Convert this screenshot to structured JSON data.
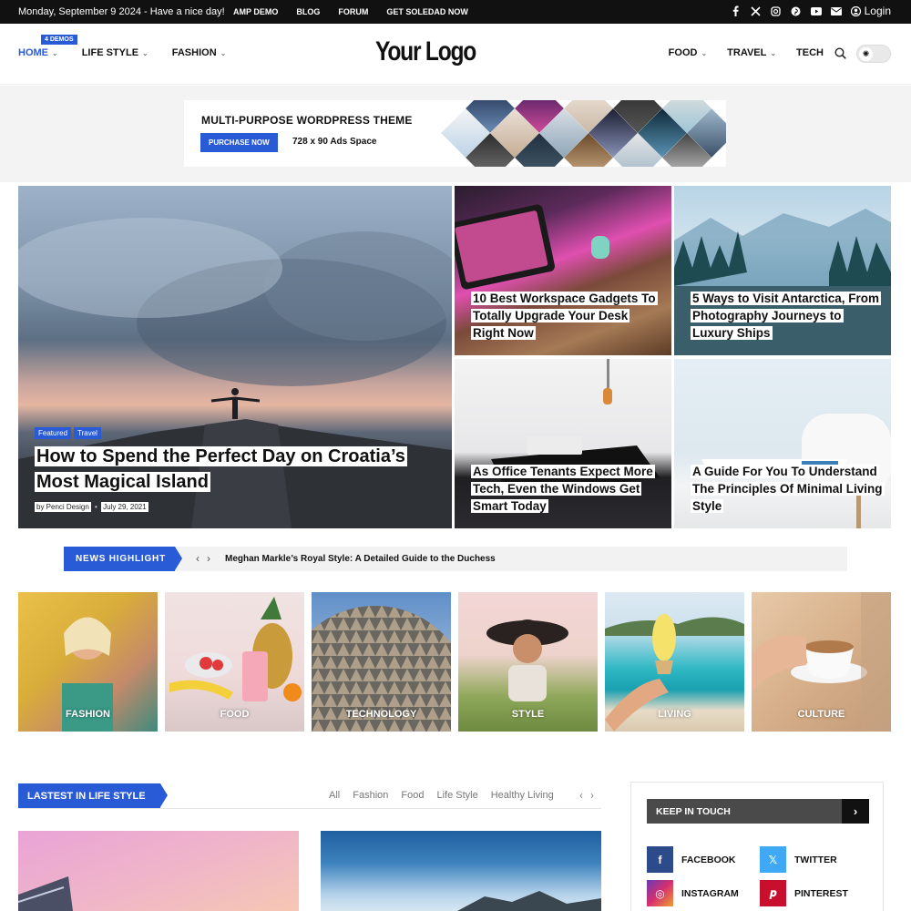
{
  "topbar": {
    "date_text": "Monday, September 9 2024 - Have a nice day!",
    "links": [
      "AMP DEMO",
      "BLOG",
      "FORUM",
      "GET SOLEDAD NOW"
    ],
    "social_icons": [
      "facebook-icon",
      "x-icon",
      "instagram-icon",
      "pinterest-icon",
      "youtube-icon",
      "mail-icon"
    ],
    "login_label": "Login"
  },
  "header": {
    "logo_text": "Your Logo",
    "badge": "4 DEMOS",
    "nav_left": [
      "HOME",
      "LIFE STYLE",
      "FASHION"
    ],
    "nav_right": [
      "FOOD",
      "TRAVEL",
      "TECH"
    ],
    "accent_color": "#2a5bd7"
  },
  "ad": {
    "title": "MULTI-PURPOSE WORDPRESS THEME",
    "button": "PURCHASE NOW",
    "space_text": "728 x 90 Ads Space"
  },
  "hero": {
    "main": {
      "tags": [
        "Featured",
        "Travel"
      ],
      "title": "How to Spend the Perfect Day on Croatia’s Most Magical Island",
      "author": "by Penci Design",
      "date": "July 29, 2021"
    },
    "cards": [
      {
        "title": "10 Best Workspace Gadgets To Totally Upgrade Your Desk Right Now"
      },
      {
        "title": "5 Ways to Visit Antarctica, From Photography Journeys to Luxury Ships"
      },
      {
        "title": "As Office Tenants Expect More Tech, Even the Windows Get Smart Today"
      },
      {
        "title": "A Guide For You To Understand The Principles Of Minimal Living Style"
      }
    ]
  },
  "ticker": {
    "label": "NEWS HIGHLIGHT",
    "headline": "Meghan Markle’s Royal Style: A Detailed Guide to the Duchess"
  },
  "categories": [
    "FASHION",
    "FOOD",
    "TECHNOLOGY",
    "STYLE",
    "LIVING",
    "CULTURE"
  ],
  "latest": {
    "label": "LASTEST IN LIFE STYLE",
    "filters": [
      "All",
      "Fashion",
      "Food",
      "Life Style",
      "Healthy Living"
    ]
  },
  "sidebar": {
    "title": "KEEP IN TOUCH",
    "socials": [
      {
        "label": "FACEBOOK",
        "icon": "facebook-icon",
        "color": "#2d4a8a"
      },
      {
        "label": "TWITTER",
        "icon": "x-icon",
        "color": "#3fa9f5"
      },
      {
        "label": "INSTAGRAM",
        "icon": "instagram-icon",
        "color": "#b0358f"
      },
      {
        "label": "PINTEREST",
        "icon": "pinterest-icon",
        "color": "#c8102e"
      }
    ]
  }
}
